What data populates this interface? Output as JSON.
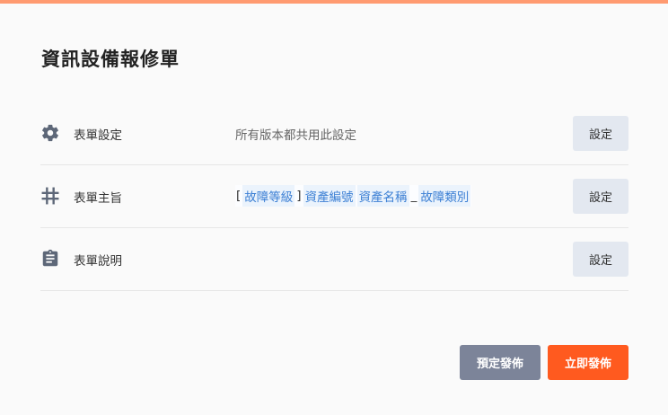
{
  "page": {
    "title": "資訊設備報修單"
  },
  "rows": [
    {
      "icon": "gear-icon",
      "label": "表單設定",
      "value": "所有版本都共用此設定",
      "button": "設定"
    },
    {
      "icon": "hash-icon",
      "label": "表單主旨",
      "subject_parts": [
        {
          "type": "text",
          "text": "["
        },
        {
          "type": "tag",
          "text": "故障等級"
        },
        {
          "type": "text",
          "text": "]"
        },
        {
          "type": "tag",
          "text": "資產編號"
        },
        {
          "type": "tag",
          "text": "資產名稱"
        },
        {
          "type": "text",
          "text": "_"
        },
        {
          "type": "tag",
          "text": "故障類別"
        }
      ],
      "button": "設定"
    },
    {
      "icon": "clipboard-icon",
      "label": "表單說明",
      "value": "",
      "button": "設定"
    }
  ],
  "footer": {
    "schedule_label": "預定發佈",
    "publish_label": "立即發佈"
  },
  "colors": {
    "accent": "#ff5a1f",
    "top_bar": "#ff9a70",
    "secondary_button": "#7c8499",
    "tag_text": "#3b7fd4",
    "tag_bg": "#ebf3fc"
  }
}
